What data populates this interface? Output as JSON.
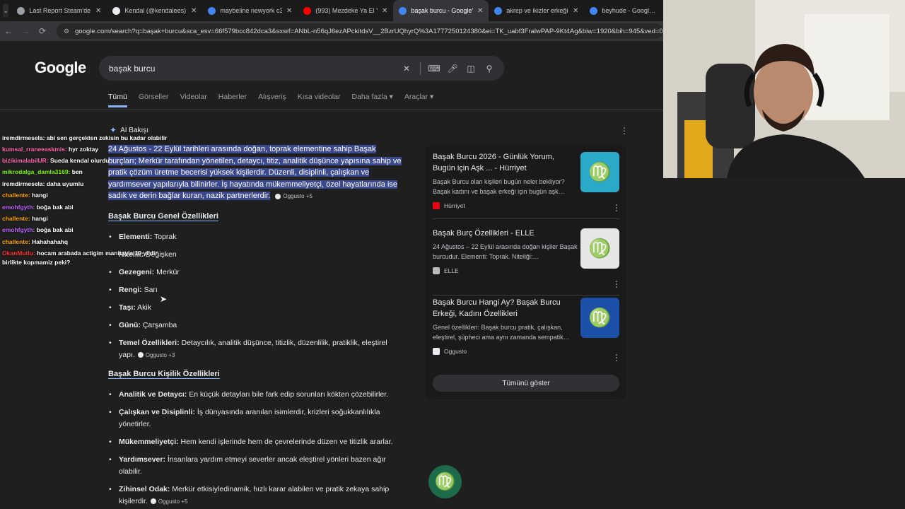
{
  "tabs": [
    {
      "title": "Last Report Steam'de %3…",
      "color": "#9aa0a6"
    },
    {
      "title": "Kendal (@kendalees) | Ti…",
      "color": "#e8eaed"
    },
    {
      "title": "maybeline newyork c36 …",
      "color": "#4285f4"
    },
    {
      "title": "(993) Mezdeke Ya El Yeli…",
      "color": "#ff0000"
    },
    {
      "title": "başak burcu - Google'da …",
      "color": "#4285f4"
    },
    {
      "title": "akrep ve ikizler erkeği u…",
      "color": "#4285f4"
    },
    {
      "title": "beyhude - Googl…",
      "color": "#4285f4"
    }
  ],
  "address": {
    "url": "google.com/search?q=başak+burcu&sca_esv=66f579bcc842dca3&sxsrf=ANbL-n56qJ6ezAPckitdsV__2BzrUQhyrQ%3A1777250124380&ei=TK_uabf3FralwPAP-9Kt4Ag&biw=1920&bih=945&ved=0ahUKE…"
  },
  "logo": "Google",
  "search": {
    "query": "başak burcu"
  },
  "navtabs": [
    "Tümü",
    "Görseller",
    "Videolar",
    "Haberler",
    "Alışveriş",
    "Kısa videolar",
    "Daha fazla ▾",
    "Araçlar ▾"
  ],
  "ai": {
    "label": "AI Bakışı",
    "summary": "24 Ağustos - 22 Eylül tarihleri arasında doğan, toprak elementine sahip Başak burçları; Merkür tarafından yönetilen, detaycı, titiz, analitik düşünce yapısına sahip ve pratik çözüm üretme becerisi yüksek kişilerdir. Düzenli, disiplinli, çalışkan ve yardımsever yapılarıyla bilinirler. İş hayatında mükemmeliyetçi, özel hayatlarında ise sadık ve derin bağlar kuran, nazik partnerlerdir.",
    "summary_src": "Oggusto +5",
    "section1": "Başak Burcu Genel Özellikleri",
    "general": [
      {
        "k": "Elementi:",
        "v": " Toprak"
      },
      {
        "k": "Nitelik:",
        "v": " Değişken"
      },
      {
        "k": "Gezegeni:",
        "v": " Merkür"
      },
      {
        "k": "Rengi:",
        "v": " Sarı"
      },
      {
        "k": "Taşı:",
        "v": " Akik"
      },
      {
        "k": "Günü:",
        "v": " Çarşamba"
      },
      {
        "k": "Temel Özellikleri:",
        "v": " Detaycılık, analitik düşünce, titizlik, düzenlilik, pratiklik, eleştirel yapı."
      }
    ],
    "general_src": "Oggusto +3",
    "section2": "Başak Burcu Kişilik Özellikleri",
    "personality": [
      {
        "k": "Analitik ve Detaycı:",
        "v": " En küçük detayları bile fark edip sorunları kökten çözebilirler."
      },
      {
        "k": "Çalışkan ve Disiplinli:",
        "v": " İş dünyasında aranılan isimlerdir, krizleri soğukkanlılıkla yönetirler."
      },
      {
        "k": "Mükemmeliyetçi:",
        "v": " Hem kendi işlerinde hem de çevrelerinde düzen ve titizlik ararlar."
      },
      {
        "k": "Yardımsever:",
        "v": " İnsanlara yardım etmeyi severler ancak eleştirel yönleri bazen ağır olabilir."
      },
      {
        "k": "Zihinsel Odak:",
        "v": " Merkür etkisiyledinamik, hızlı karar alabilen ve pratik zekaya sahip kişilerdir."
      }
    ],
    "personality_src": "Oggusto +5"
  },
  "chat": [
    {
      "user": "iremdirmesela:",
      "msg": "abi sen gerçekten zekisin bu kadar olabilir",
      "color": "#ffffff"
    },
    {
      "user": "kumsal_rraneeaskmis:",
      "msg": "hyr zoktay",
      "color": "#ff69b4"
    },
    {
      "user": "bizikimalabilUR:",
      "msg": "Sueda kendal olurdu",
      "color": "#ff69b4"
    },
    {
      "user": "mikrodalga_damla3169:",
      "msg": "ben",
      "color": "#7cfc00"
    },
    {
      "user": "iremdirmesela:",
      "msg": "daha uyumlu",
      "color": "#ffffff"
    },
    {
      "user": "challente:",
      "msg": "hangi",
      "color": "#ffa500"
    },
    {
      "user": "emohfgyth:",
      "msg": "boğa bak abi",
      "color": "#bb66ff"
    },
    {
      "user": "challente:",
      "msg": "hangi",
      "color": "#ffa500"
    },
    {
      "user": "emohfgyth:",
      "msg": "boğa bak abi",
      "color": "#bb66ff"
    },
    {
      "user": "challente:",
      "msg": "Hahahahahq",
      "color": "#ffa500"
    },
    {
      "user": "OkanMutlu:",
      "msg": "hocam arabada actigim manitayla 10 yildir",
      "color": "#ff3333"
    },
    {
      "user": "",
      "msg": "birlikte kopmamiz peki?",
      "color": "#ffffff"
    }
  ],
  "results": [
    {
      "title": "Başak Burcu 2026 - Günlük Yorum, Bugün için Aşk ... - Hürriyet",
      "desc": "Başak Burcu olan kişileri bugün neler bekliyor? Başak kadını ve başak erkeği için bugün aşk…",
      "source": "Hürriyet",
      "sourceColor": "#e30613",
      "thumbColor": "#2aa9c9"
    },
    {
      "title": "Başak Burç Özellikleri - ELLE",
      "desc": "24 Ağustos – 22 Eylül arasında doğan kişiler Başak burcudur. Elementi: Toprak. Niteliği:…",
      "source": "ELLE",
      "sourceColor": "#bbbbbb",
      "thumbColor": "#e6e6e6"
    },
    {
      "title": "Başak Burcu Hangi Ay? Başak Burcu Erkeği, Kadını Özellikleri",
      "desc": "Genel özellikleri: Başak burcu pratik, çalışkan, eleştirel, şüpheci ama aynı zamanda sempatik…",
      "source": "Oggusto",
      "sourceColor": "#e8eaed",
      "thumbColor": "#1b4fa8"
    }
  ],
  "show_all": "Tümünü göster",
  "virgo_glyph": "♍"
}
